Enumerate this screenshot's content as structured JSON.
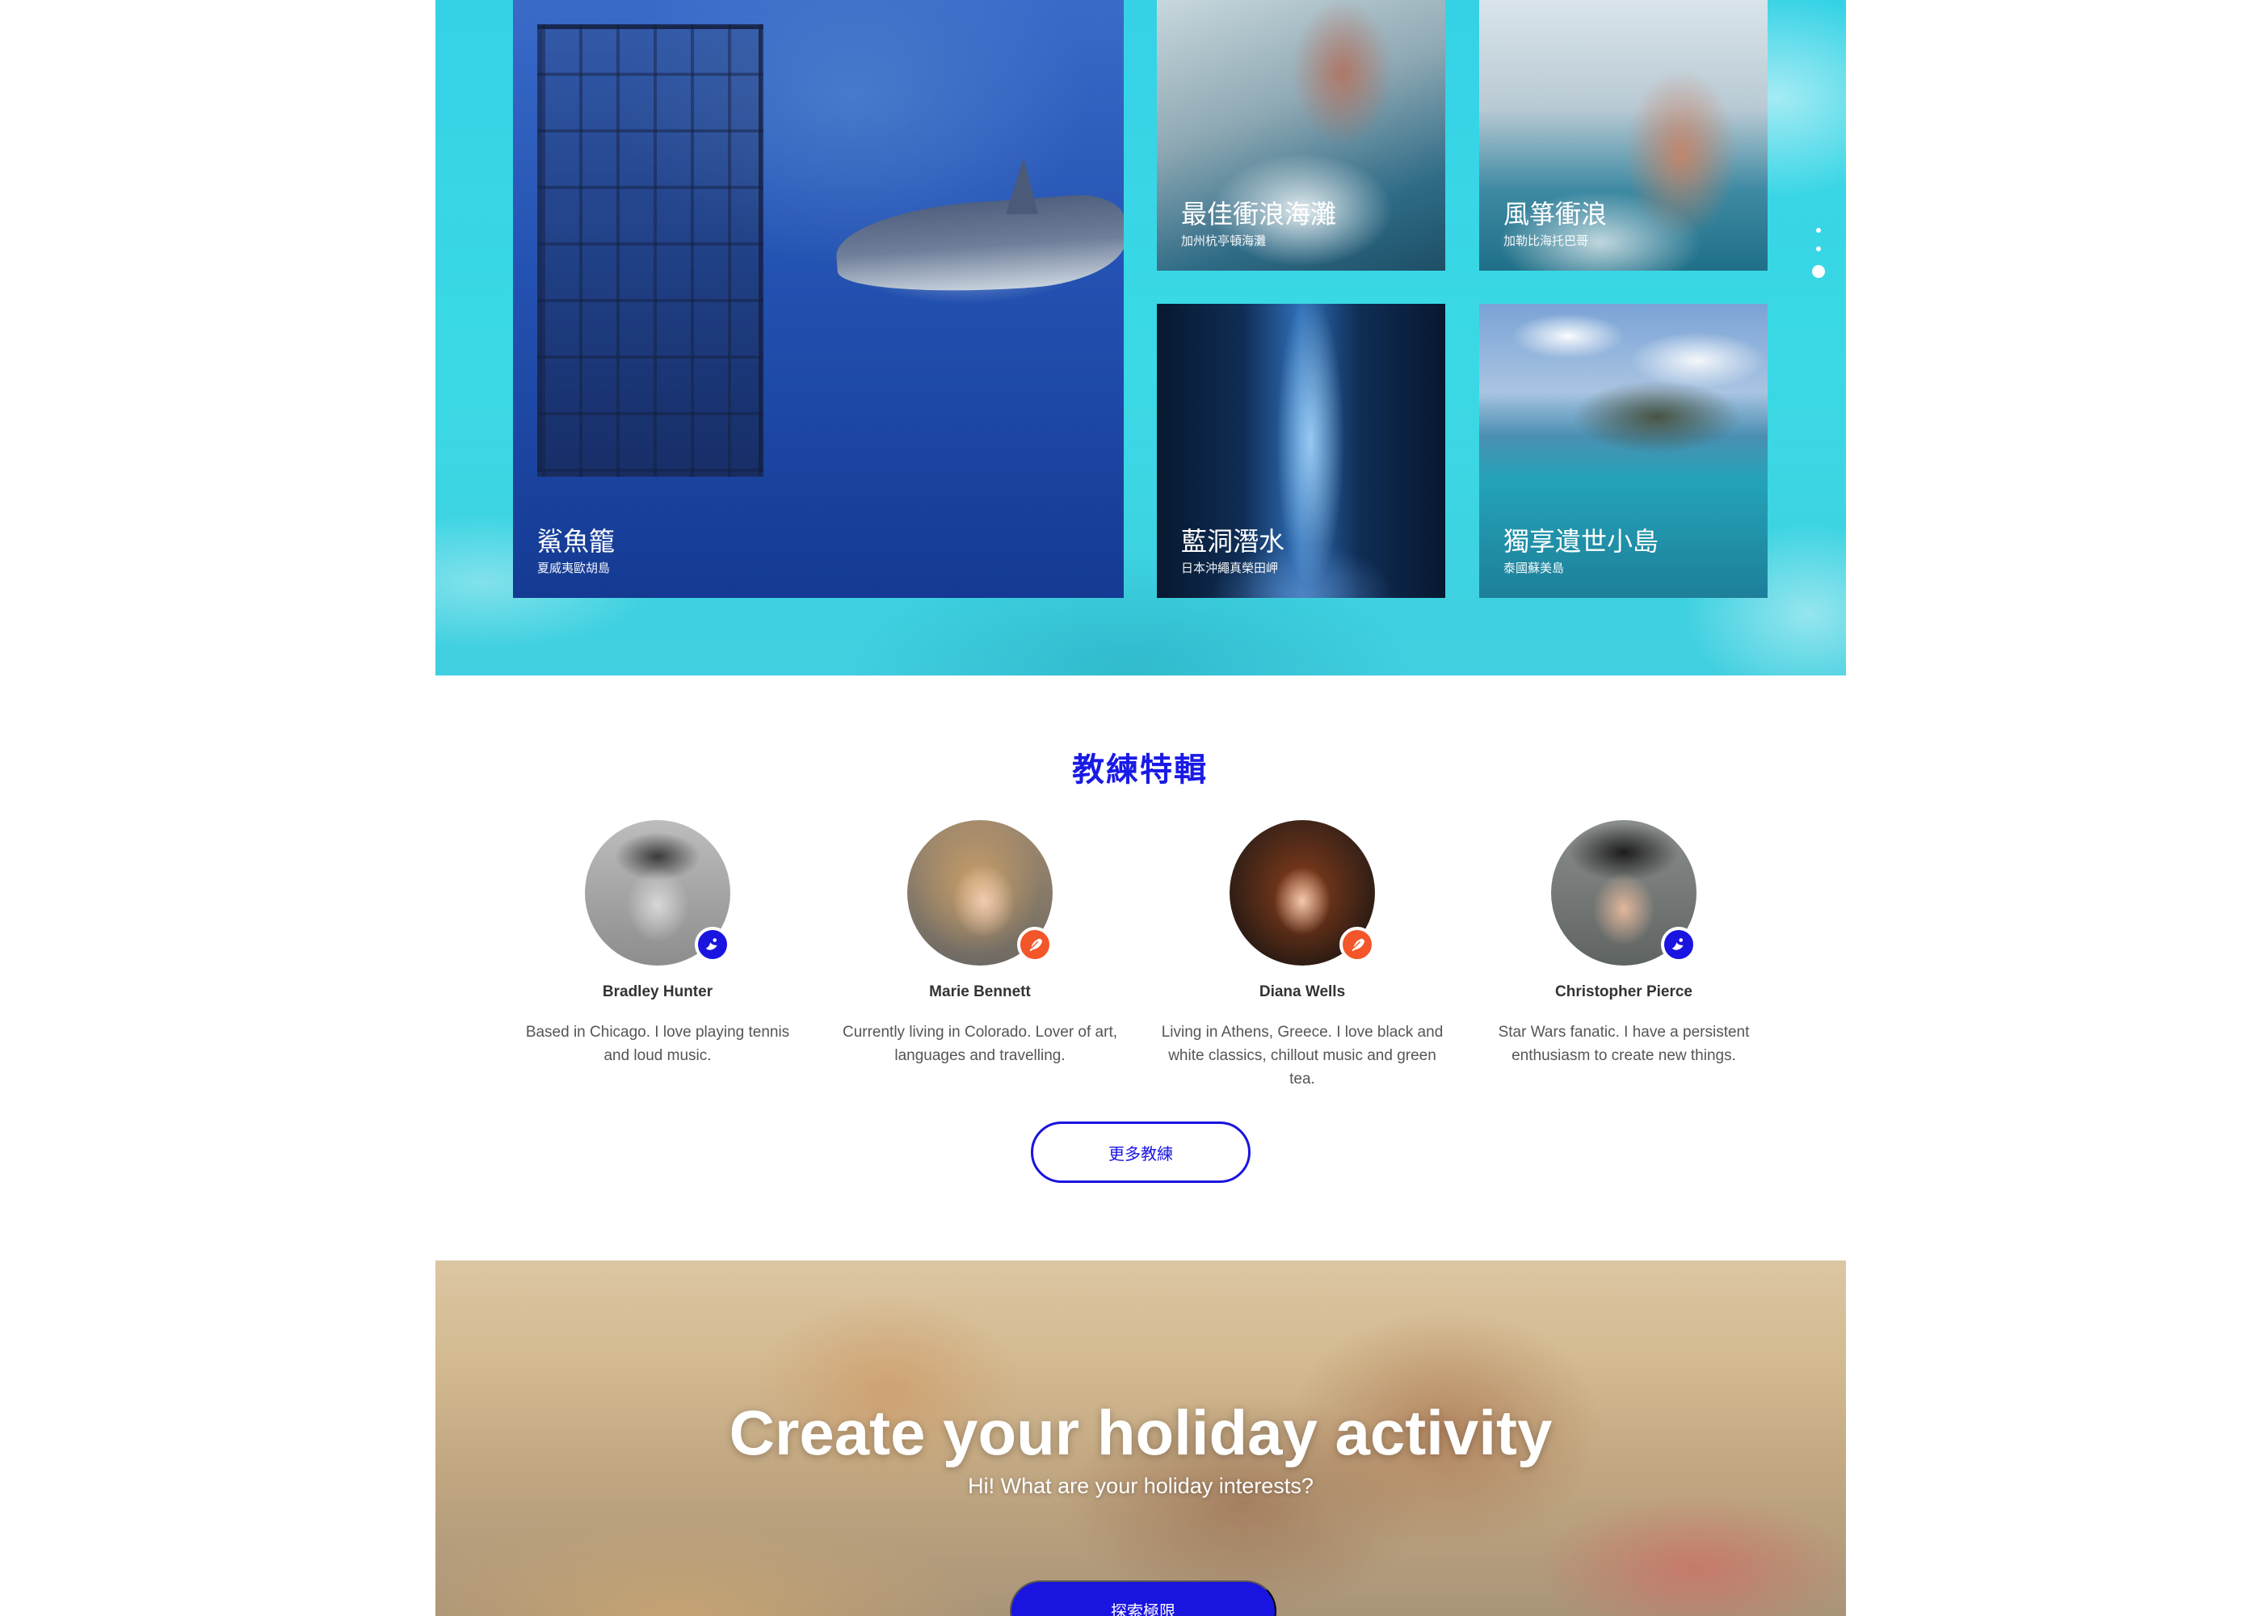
{
  "destinations": {
    "tiles": [
      {
        "title": "鯊魚籠",
        "subtitle": "夏威夷歐胡島"
      },
      {
        "title": "最佳衝浪海灘",
        "subtitle": "加州杭亭頓海灘"
      },
      {
        "title": "風箏衝浪",
        "subtitle": "加勒比海托巴哥"
      },
      {
        "title": "藍洞潛水",
        "subtitle": "日本沖繩真榮田岬"
      },
      {
        "title": "獨享遺世小島",
        "subtitle": "泰國蘇美島"
      }
    ],
    "active_page": 3,
    "page_count": 3
  },
  "coaches": {
    "title": "教練特輯",
    "items": [
      {
        "name": "Bradley Hunter",
        "bio": "Based in Chicago. I love playing tennis and loud music.",
        "badge_icon": "surf-icon",
        "badge_color": "#1a14e0"
      },
      {
        "name": "Marie Bennett",
        "bio": "Currently living in Colorado. Lover of art, languages and travelling.",
        "badge_icon": "feather-icon",
        "badge_color": "#f2562a"
      },
      {
        "name": "Diana Wells",
        "bio": "Living in Athens, Greece. I love black and white classics, chillout music and green tea.",
        "badge_icon": "feather-icon",
        "badge_color": "#f2562a"
      },
      {
        "name": "Christopher Pierce",
        "bio": "Star Wars fanatic. I have a persistent enthusiasm to create new things.",
        "badge_icon": "surf-icon",
        "badge_color": "#1a14e0"
      }
    ],
    "more_label": "更多教練"
  },
  "holiday": {
    "title": "Create your holiday activity",
    "subtitle": "Hi! What are your holiday interests?",
    "cta_label": "探索極限"
  },
  "colors": {
    "accent": "#1a14e0",
    "orange": "#f2562a",
    "panel": "#3ad9e5"
  }
}
